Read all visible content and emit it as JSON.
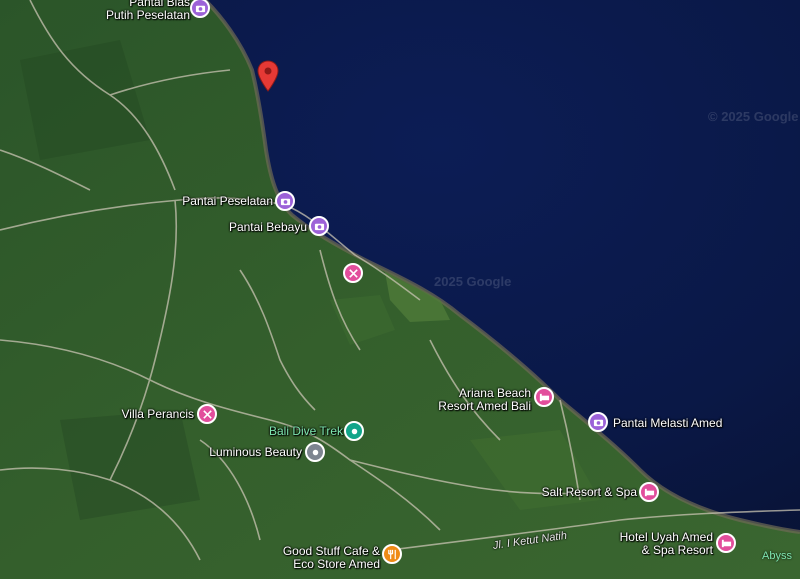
{
  "map": {
    "view": "satellite",
    "colors": {
      "sea": "#0a1a4c",
      "land": "#2f5a2a",
      "place_pin": "#9c62d8",
      "hotel_pin": "#e24e9c",
      "dive_pin": "#12a58a",
      "food_pin": "#ef8b16",
      "dropped_pin": "#e53935"
    },
    "watermark_text": "© 2025 Google",
    "watermark_center": "2025 Google",
    "road_label": "Jl. I Ketut Natih",
    "sea_partial_label": "Abyss",
    "places": {
      "pantai_bias_line1": "Pantai Bias",
      "pantai_bias_line2": "Putih Peselatan",
      "pantai_peselatan": "Pantai Peselatan",
      "pantai_bebayu": "Pantai Bebayu",
      "ariana_line1": "Ariana Beach",
      "ariana_line2": "Resort Amed Bali",
      "pantai_melasti": "Pantai Melasti Amed",
      "villa_perancis": "Villa Perancis",
      "bali_dive_trek": "Bali Dive Trek",
      "luminous_beauty": "Luminous Beauty",
      "salt_resort": "Salt Resort & Spa",
      "good_stuff_line1": "Good Stuff Cafe &",
      "good_stuff_line2": "Eco Store Amed",
      "hotel_uyah_line1": "Hotel Uyah Amed",
      "hotel_uyah_line2": "& Spa Resort"
    }
  }
}
